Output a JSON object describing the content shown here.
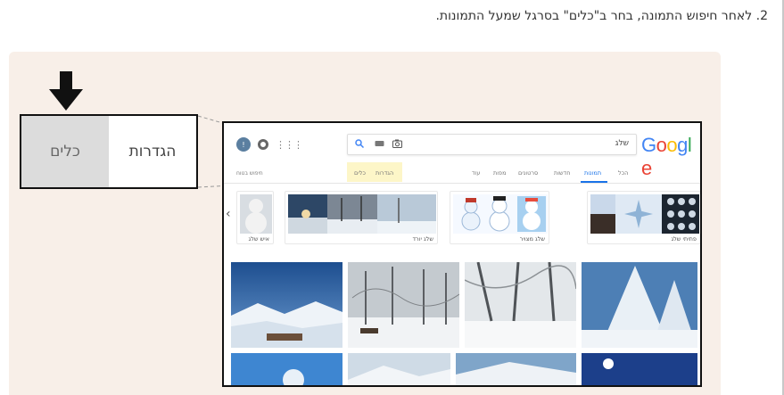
{
  "instruction": "2. לאחר חיפוש התמונה, בחר ב\"כלים\" בסרגל שמעל התמונות.",
  "callout": {
    "tools_label": "כלים",
    "settings_label": "הגדרות"
  },
  "google": {
    "logo": [
      "G",
      "o",
      "o",
      "g",
      "l",
      "e"
    ],
    "logo_colors": [
      "#4285f4",
      "#ea4335",
      "#fbbc05",
      "#4285f4",
      "#34a853",
      "#ea4335"
    ],
    "search_query": "שלג",
    "avatar_letter": "!",
    "tabs": [
      {
        "label": "הכל"
      },
      {
        "label": "תמונות"
      },
      {
        "label": "חדשות"
      },
      {
        "label": "סרטונים"
      },
      {
        "label": "מפות"
      },
      {
        "label": "עוד"
      }
    ],
    "settings_tab": "הגדרות",
    "tools_tab": "כלים",
    "safe_search": "חיפוש בטוח",
    "related": [
      {
        "label": "פתיתי שלג"
      },
      {
        "label": "שלג מצויר"
      },
      {
        "label": "שלג יורד"
      },
      {
        "label": "איש שלג"
      }
    ]
  },
  "colors": {
    "panel_bg": "#f8efe8",
    "accent_blue": "#1a73e8",
    "highlight": "#fdf6c8"
  }
}
